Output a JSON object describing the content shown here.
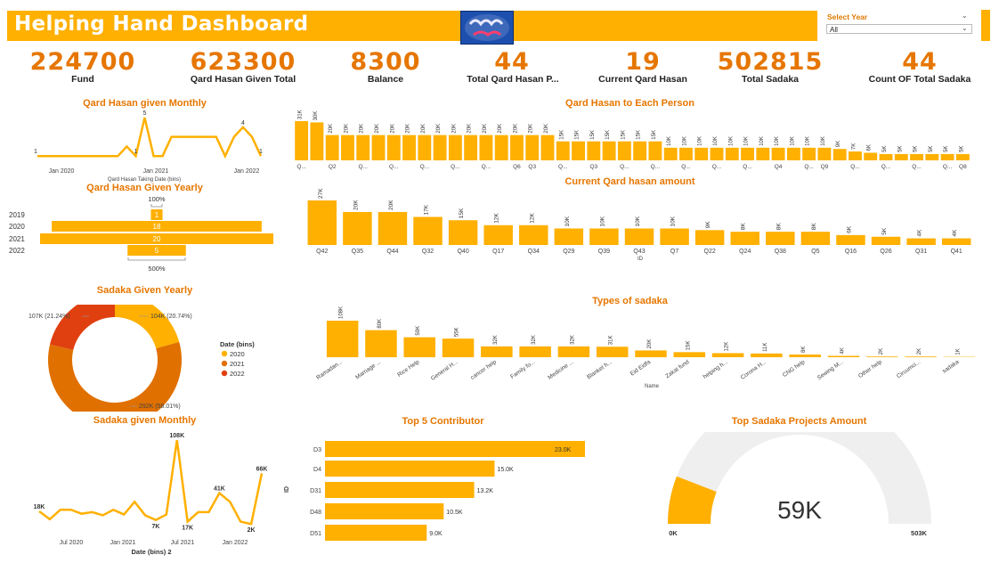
{
  "header": {
    "title": "Helping Hand Dashboard",
    "select_year_label": "Select Year",
    "select_year_value": "All"
  },
  "colors": {
    "accent": "#ffb000",
    "kpi": "#e67600",
    "bar": "#ffb000",
    "dark": "#e07000",
    "red": "#e0400f",
    "gauge_bg": "#efefef"
  },
  "kpis": [
    {
      "value": "224700",
      "label": "Fund"
    },
    {
      "value": "623300",
      "label": "Qard Hasan Given Total"
    },
    {
      "value": "8300",
      "label": "Balance"
    },
    {
      "value": "44",
      "label": "Total Qard Hasan P..."
    },
    {
      "value": "19",
      "label": "Current Qard Hasan"
    },
    {
      "value": "502815",
      "label": "Total Sadaka"
    },
    {
      "value": "44",
      "label": "Count OF Total Sadaka"
    }
  ],
  "charts": {
    "qh_monthly": {
      "title": "Qard Hasan given Monthly",
      "xlabel": "Qard Hasan Taking Date (bins)",
      "ticks": [
        "Jan 2020",
        "Jan 2021",
        "Jan 2022"
      ],
      "labels": [
        "1",
        "5",
        "1",
        "4",
        "1"
      ],
      "chart_data": {
        "type": "line",
        "values": [
          1,
          1,
          1,
          1,
          1,
          1,
          1,
          1,
          1,
          1,
          2,
          1,
          5,
          1,
          1,
          3,
          3,
          3,
          3,
          3,
          3,
          1,
          3,
          4,
          3,
          1
        ]
      }
    },
    "qh_yearly": {
      "title": "Qard Hasan Given Yearly",
      "top_label": "100%",
      "bottom_label": "500%",
      "chart_data": {
        "type": "bar",
        "categories": [
          "2019",
          "2020",
          "2021",
          "2022"
        ],
        "values": [
          1,
          18,
          20,
          5
        ]
      }
    },
    "qh_person": {
      "title": "Qard Hasan to Each Person",
      "chart_data": {
        "type": "bar",
        "categories": [
          "Q...",
          "",
          "Q2",
          "",
          "Q...",
          "",
          "Q...",
          "",
          "Q...",
          "",
          "Q...",
          "",
          "Q...",
          "",
          "Q6",
          "Q3",
          "",
          "Q...",
          "",
          "Q3",
          "",
          "Q...",
          "",
          "Q...",
          "",
          "Q...",
          "",
          "Q...",
          "",
          "Q...",
          "",
          "Q4",
          "",
          "Q...",
          "Q9",
          "",
          "Q...",
          "",
          "Q...",
          "",
          "Q...",
          "",
          "Q...",
          "Q8"
        ],
        "values": [
          31,
          30,
          20,
          20,
          20,
          20,
          20,
          20,
          20,
          20,
          20,
          20,
          20,
          20,
          20,
          20,
          20,
          15,
          15,
          15,
          15,
          15,
          15,
          15,
          10,
          10,
          10,
          10,
          10,
          10,
          10,
          10,
          10,
          10,
          10,
          9,
          7,
          6,
          5,
          5,
          5,
          5,
          5,
          5
        ],
        "value_labels": [
          "31K",
          "30K",
          "20K",
          "20K",
          "20K",
          "20K",
          "20K",
          "20K",
          "20K",
          "20K",
          "20K",
          "20K",
          "20K",
          "20K",
          "20K",
          "20K",
          "20K",
          "15K",
          "15K",
          "15K",
          "15K",
          "15K",
          "15K",
          "15K",
          "10K",
          "10K",
          "10K",
          "10K",
          "10K",
          "10K",
          "10K",
          "10K",
          "10K",
          "10K",
          "10K",
          "9K",
          "7K",
          "6K",
          "5K",
          "5K",
          "5K",
          "5K",
          "5K",
          "5K"
        ]
      }
    },
    "current_qh": {
      "title": "Current Qard hasan amount",
      "xlabel": "ID",
      "chart_data": {
        "type": "bar",
        "categories": [
          "Q42",
          "Q35",
          "Q44",
          "Q32",
          "Q40",
          "Q17",
          "Q34",
          "Q29",
          "Q39",
          "Q43",
          "Q7",
          "Q22",
          "Q24",
          "Q38",
          "Q5",
          "Q16",
          "Q26",
          "Q31",
          "Q41"
        ],
        "values": [
          27,
          20,
          20,
          17,
          15,
          12,
          12,
          10,
          10,
          10,
          10,
          9,
          8,
          8,
          8,
          6,
          5,
          4,
          4
        ],
        "value_labels": [
          "27K",
          "20K",
          "20K",
          "17K",
          "15K",
          "12K",
          "12K",
          "10K",
          "10K",
          "10K",
          "10K",
          "9K",
          "8K",
          "8K",
          "8K",
          "6K",
          "5K",
          "4K",
          "4K"
        ]
      }
    },
    "sadaka_yearly": {
      "title": "Sadaka Given Yearly",
      "legend_title": "Date (bins)",
      "labels": [
        "104K (20.74%)",
        "292K (58.01%)",
        "107K (21.24%)"
      ],
      "chart_data": {
        "type": "pie",
        "categories": [
          "2020",
          "2021",
          "2022"
        ],
        "values": [
          104,
          292,
          107
        ]
      }
    },
    "sadaka_types": {
      "title": "Types of sadaka",
      "xlabel": "Name",
      "chart_data": {
        "type": "bar",
        "categories": [
          "Ramadan...",
          "Marriage ...",
          "Rice Help",
          "General H...",
          "cancer help",
          "Family fo...",
          "Medicine ...",
          "Blanket h...",
          "Eid Eidfa",
          "Zakat fund",
          "helping h...",
          "Corona H...",
          "CNG help",
          "Sewing M...",
          "Other help",
          "Circumci...",
          "sadaka"
        ],
        "values": [
          108,
          80,
          59,
          55,
          32,
          32,
          32,
          31,
          20,
          15,
          12,
          11,
          8,
          4,
          2,
          2,
          1
        ],
        "value_labels": [
          "108K",
          "80K",
          "59K",
          "55K",
          "32K",
          "32K",
          "32K",
          "31K",
          "20K",
          "15K",
          "12K",
          "11K",
          "8K",
          "4K",
          "2K",
          "2K",
          "1K"
        ]
      }
    },
    "sadaka_monthly": {
      "title": "Sadaka given Monthly",
      "xlabel": "Date (bins) 2",
      "ticks": [
        "Jul 2020",
        "Jan 2021",
        "Jul 2021",
        "Jan 2022"
      ],
      "labels": [
        "18K",
        "108K",
        "7K",
        "17K",
        "41K",
        "2K",
        "66K"
      ],
      "chart_data": {
        "type": "line",
        "values": [
          18,
          8,
          20,
          20,
          15,
          17,
          13,
          20,
          14,
          30,
          13,
          7,
          14,
          108,
          5,
          17,
          17,
          41,
          30,
          5,
          2,
          66
        ]
      }
    },
    "top5": {
      "title": "Top 5 Contributor",
      "ylabel": "ID",
      "chart_data": {
        "type": "bar",
        "categories": [
          "D3",
          "D4",
          "D31",
          "D48",
          "D51"
        ],
        "values": [
          23.0,
          15.0,
          13.2,
          10.5,
          9.0
        ],
        "value_labels": [
          "23.0K",
          "15.0K",
          "13.2K",
          "10.5K",
          "9.0K"
        ]
      }
    },
    "gauge": {
      "title": "Top Sadaka Projects Amount",
      "value_label": "59K",
      "min_label": "0K",
      "max_label": "503K",
      "chart_data": {
        "type": "gauge",
        "value": 59,
        "min": 0,
        "max": 503
      }
    }
  }
}
